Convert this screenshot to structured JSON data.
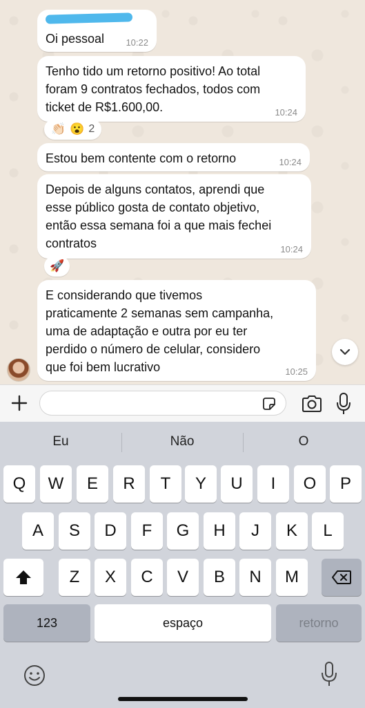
{
  "messages": [
    {
      "text": "Oi pessoal",
      "time": "10:22"
    },
    {
      "text": "Tenho tido um retorno positivo! Ao total\nforam 9 contratos fechados, todos com\nticket de R$1.600,00.",
      "time": "10:24"
    },
    {
      "text": "Estou bem contente com o retorno",
      "time": "10:24"
    },
    {
      "text": "Depois de alguns contatos, aprendi que\nesse público gosta de contato objetivo,\nentão essa semana foi a que mais fechei\ncontratos",
      "time": "10:24"
    },
    {
      "text": "E considerando que tivemos\npraticamente 2 semanas sem campanha,\numa de adaptação e outra por eu ter\nperdido o número de celular, considero\nque foi bem lucrativo",
      "time": "10:25"
    }
  ],
  "reactions": {
    "first": {
      "emojis": [
        "👏🏻",
        "😮"
      ],
      "count": "2"
    },
    "second": {
      "emojis": [
        "🚀"
      ]
    }
  },
  "keyboard": {
    "suggestions": [
      "Eu",
      "Não",
      "O"
    ],
    "row1": [
      "Q",
      "W",
      "E",
      "R",
      "T",
      "Y",
      "U",
      "I",
      "O",
      "P"
    ],
    "row2": [
      "A",
      "S",
      "D",
      "F",
      "G",
      "H",
      "J",
      "K",
      "L"
    ],
    "row3": [
      "Z",
      "X",
      "C",
      "V",
      "B",
      "N",
      "M"
    ],
    "numbers_label": "123",
    "space_label": "espaço",
    "return_label": "retorno"
  },
  "icons": {
    "plus": "plus-icon",
    "sticker": "sticker-icon",
    "camera": "camera-icon",
    "mic": "microphone-icon",
    "shift": "shift-icon",
    "backspace": "backspace-icon",
    "emoji": "emoji-icon",
    "dictation": "microphone-icon",
    "scroll_down": "chevron-down-icon"
  },
  "colors": {
    "chat_background": "#efe7dd",
    "bubble": "#ffffff",
    "keyboard_background": "#d1d4db",
    "redacted_name": "#4fb8ec"
  }
}
